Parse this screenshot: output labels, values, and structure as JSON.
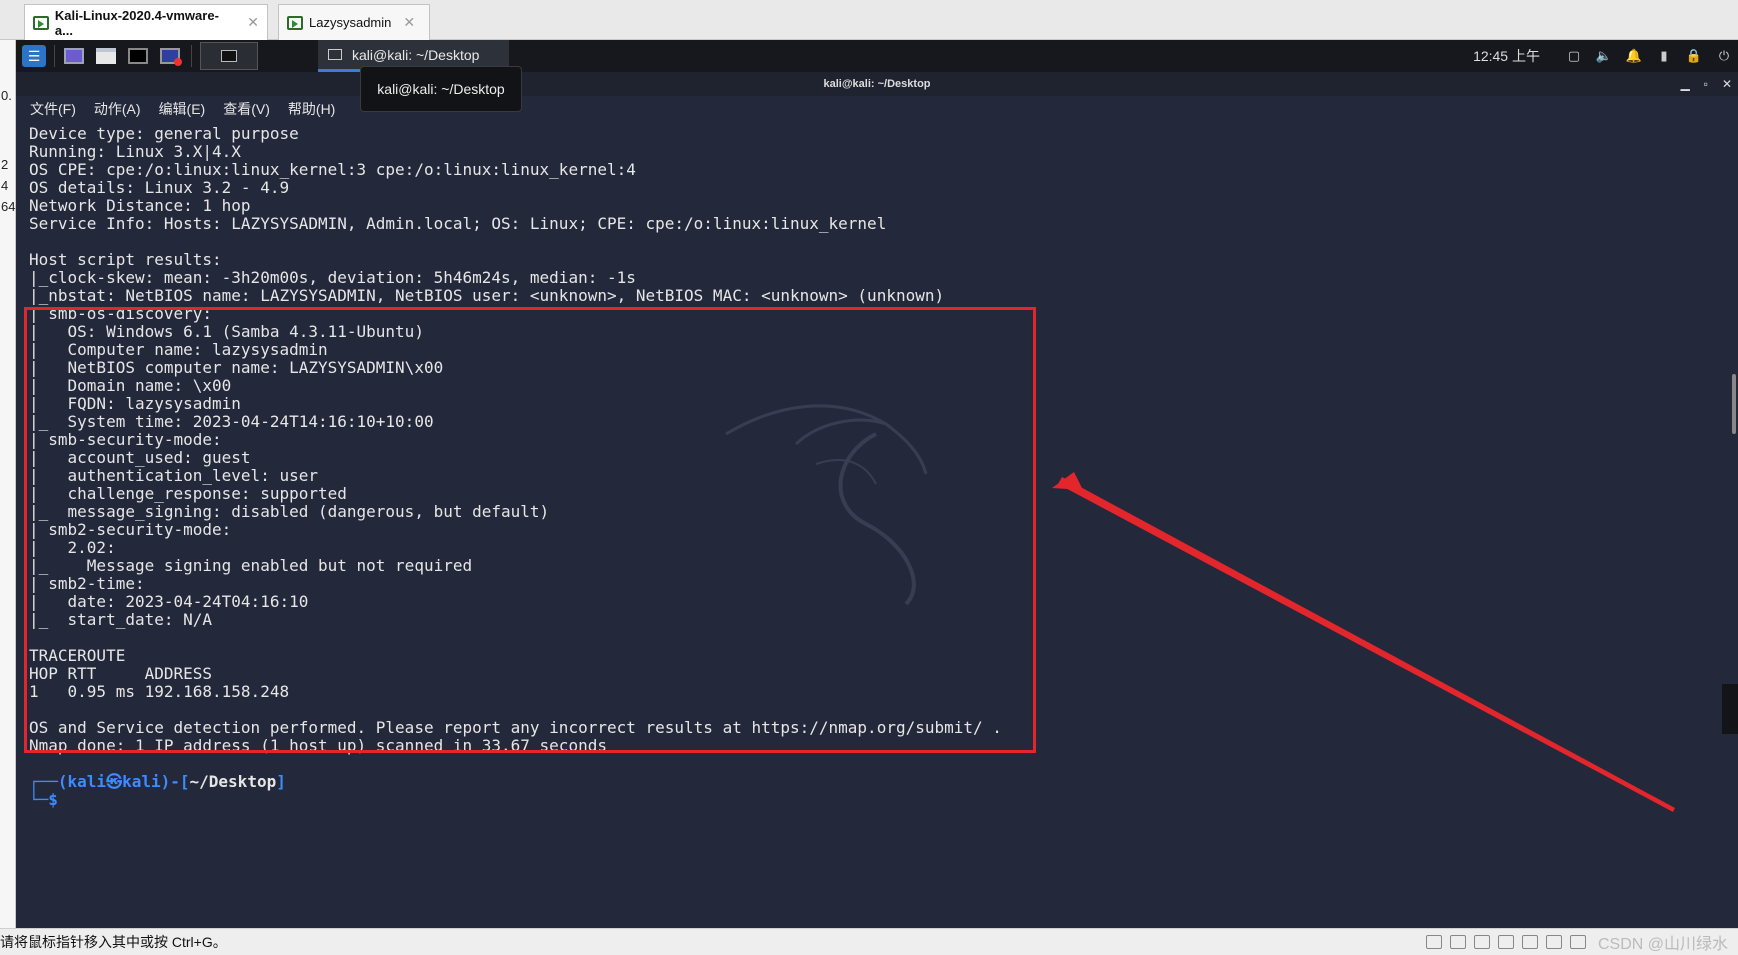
{
  "vm_tabs": [
    {
      "label": "Kali-Linux-2020.4-vmware-a...",
      "active": true
    },
    {
      "label": "Lazysysadmin",
      "active": false
    }
  ],
  "left_strip": [
    "x",
    "0.",
    "2",
    "4",
    "64"
  ],
  "panel": {
    "window_label": "kali@kali: ~/Desktop",
    "clock": "12:45 上午"
  },
  "tooltip": "kali@kali: ~/Desktop",
  "terminal": {
    "title": "kali@kali: ~/Desktop",
    "menu": [
      "文件(F)",
      "动作(A)",
      "编辑(E)",
      "查看(V)",
      "帮助(H)"
    ],
    "lines": [
      "Device type: general purpose",
      "Running: Linux 3.X|4.X",
      "OS CPE: cpe:/o:linux:linux_kernel:3 cpe:/o:linux:linux_kernel:4",
      "OS details: Linux 3.2 - 4.9",
      "Network Distance: 1 hop",
      "Service Info: Hosts: LAZYSYSADMIN, Admin.local; OS: Linux; CPE: cpe:/o:linux:linux_kernel",
      "",
      "Host script results:",
      "|_clock-skew: mean: -3h20m00s, deviation: 5h46m24s, median: -1s",
      "|_nbstat: NetBIOS name: LAZYSYSADMIN, NetBIOS user: <unknown>, NetBIOS MAC: <unknown> (unknown)",
      "| smb-os-discovery:",
      "|   OS: Windows 6.1 (Samba 4.3.11-Ubuntu)",
      "|   Computer name: lazysysadmin",
      "|   NetBIOS computer name: LAZYSYSADMIN\\x00",
      "|   Domain name: \\x00",
      "|   FQDN: lazysysadmin",
      "|_  System time: 2023-04-24T14:16:10+10:00",
      "| smb-security-mode:",
      "|   account_used: guest",
      "|   authentication_level: user",
      "|   challenge_response: supported",
      "|_  message_signing: disabled (dangerous, but default)",
      "| smb2-security-mode:",
      "|   2.02:",
      "|_    Message signing enabled but not required",
      "| smb2-time:",
      "|   date: 2023-04-24T04:16:10",
      "|_  start_date: N/A",
      "",
      "TRACEROUTE",
      "HOP RTT     ADDRESS",
      "1   0.95 ms 192.168.158.248",
      "",
      "OS and Service detection performed. Please report any incorrect results at https://nmap.org/submit/ .",
      "Nmap done: 1 IP address (1 host up) scanned in 33.67 seconds"
    ],
    "prompt": {
      "open": "┌──(",
      "user": "kali㉿kali",
      "mid": ")-[",
      "path": "~/Desktop",
      "close": "]",
      "second": "└─",
      "dollar": "$"
    }
  },
  "status_bar": {
    "message": "请将鼠标指针移入其中或按 Ctrl+G。",
    "watermark": "CSDN @山川绿水"
  },
  "colors": {
    "terminal_bg": "#23283a",
    "highlight": "#e3262c",
    "prompt_blue": "#3d8cff"
  }
}
